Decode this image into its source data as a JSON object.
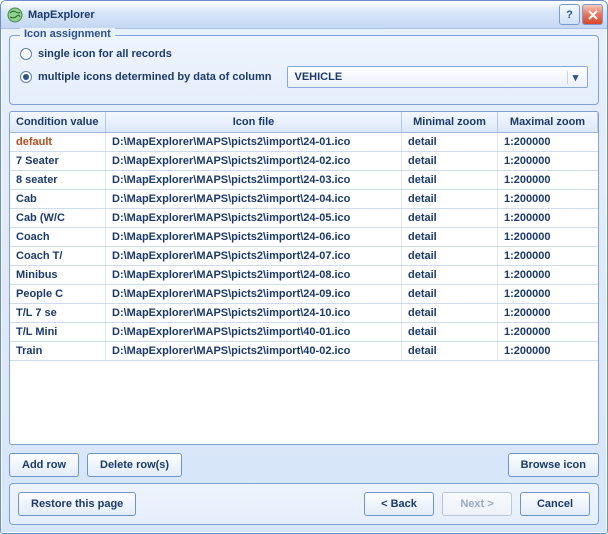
{
  "window": {
    "title": "MapExplorer"
  },
  "group": {
    "legend": "Icon assignment",
    "radio_single": "single icon for all records",
    "radio_multiple": "multiple icons determined by data of column",
    "selected": "multiple",
    "column_value": "VEHICLE"
  },
  "table": {
    "headers": {
      "condition": "Condition value",
      "iconfile": "Icon file",
      "minzoom": "Minimal zoom",
      "maxzoom": "Maximal zoom"
    },
    "rows": [
      {
        "condition": "default",
        "is_default": true,
        "iconfile": "D:\\MapExplorer\\MAPS\\picts2\\import\\24-01.ico",
        "minzoom": "detail",
        "maxzoom": "1:200000"
      },
      {
        "condition": "7 Seater",
        "iconfile": "D:\\MapExplorer\\MAPS\\picts2\\import\\24-02.ico",
        "minzoom": "detail",
        "maxzoom": "1:200000"
      },
      {
        "condition": "8 seater",
        "iconfile": "D:\\MapExplorer\\MAPS\\picts2\\import\\24-03.ico",
        "minzoom": "detail",
        "maxzoom": "1:200000"
      },
      {
        "condition": "Cab",
        "iconfile": "D:\\MapExplorer\\MAPS\\picts2\\import\\24-04.ico",
        "minzoom": "detail",
        "maxzoom": "1:200000"
      },
      {
        "condition": "Cab (W/C",
        "iconfile": "D:\\MapExplorer\\MAPS\\picts2\\import\\24-05.ico",
        "minzoom": "detail",
        "maxzoom": "1:200000"
      },
      {
        "condition": "Coach",
        "iconfile": "D:\\MapExplorer\\MAPS\\picts2\\import\\24-06.ico",
        "minzoom": "detail",
        "maxzoom": "1:200000"
      },
      {
        "condition": "Coach T/",
        "iconfile": "D:\\MapExplorer\\MAPS\\picts2\\import\\24-07.ico",
        "minzoom": "detail",
        "maxzoom": "1:200000"
      },
      {
        "condition": "Minibus",
        "iconfile": "D:\\MapExplorer\\MAPS\\picts2\\import\\24-08.ico",
        "minzoom": "detail",
        "maxzoom": "1:200000"
      },
      {
        "condition": "People C",
        "iconfile": "D:\\MapExplorer\\MAPS\\picts2\\import\\24-09.ico",
        "minzoom": "detail",
        "maxzoom": "1:200000"
      },
      {
        "condition": "T/L 7 se",
        "iconfile": "D:\\MapExplorer\\MAPS\\picts2\\import\\24-10.ico",
        "minzoom": "detail",
        "maxzoom": "1:200000"
      },
      {
        "condition": "T/L Mini",
        "iconfile": "D:\\MapExplorer\\MAPS\\picts2\\import\\40-01.ico",
        "minzoom": "detail",
        "maxzoom": "1:200000"
      },
      {
        "condition": "Train",
        "iconfile": "D:\\MapExplorer\\MAPS\\picts2\\import\\40-02.ico",
        "minzoom": "detail",
        "maxzoom": "1:200000"
      }
    ]
  },
  "buttons": {
    "add_row": "Add row",
    "delete_rows": "Delete row(s)",
    "browse_icon": "Browse icon",
    "restore": "Restore this page",
    "back": "< Back",
    "next": "Next >",
    "cancel": "Cancel"
  }
}
